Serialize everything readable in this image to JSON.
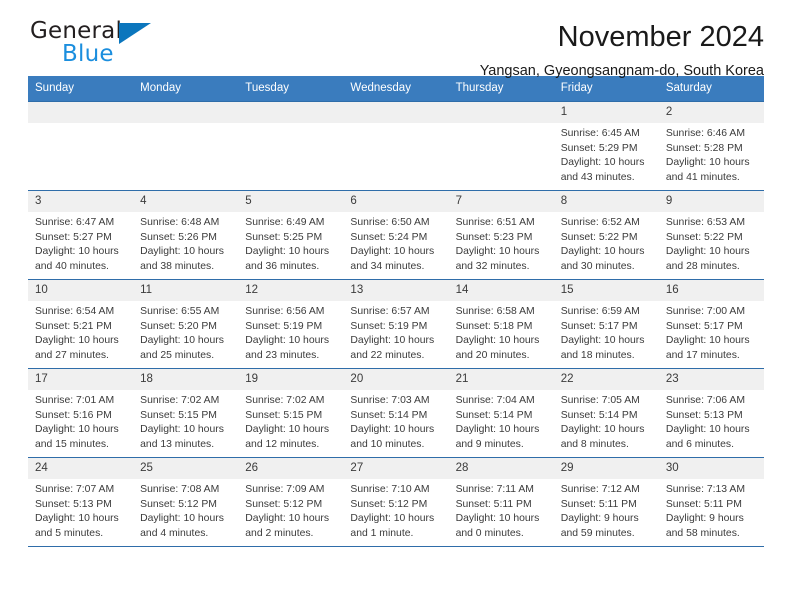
{
  "brand": {
    "name_part1": "General",
    "name_part2": "Blue",
    "triangle_color": "#0b76bd",
    "blue_text_color": "#1b8ede"
  },
  "header": {
    "title": "November 2024",
    "subtitle": "Yangsan, Gyeongsangnam-do, South Korea",
    "header_bg_color": "#3a7cbe",
    "row_border_color": "#2f6da9",
    "daynum_bg_color": "#f0f0f0"
  },
  "weekday_headers": [
    "Sunday",
    "Monday",
    "Tuesday",
    "Wednesday",
    "Thursday",
    "Friday",
    "Saturday"
  ],
  "weeks": [
    [
      {
        "day": "",
        "lines": []
      },
      {
        "day": "",
        "lines": []
      },
      {
        "day": "",
        "lines": []
      },
      {
        "day": "",
        "lines": []
      },
      {
        "day": "",
        "lines": []
      },
      {
        "day": "1",
        "lines": [
          "Sunrise: 6:45 AM",
          "Sunset: 5:29 PM",
          "Daylight: 10 hours",
          "and 43 minutes."
        ]
      },
      {
        "day": "2",
        "lines": [
          "Sunrise: 6:46 AM",
          "Sunset: 5:28 PM",
          "Daylight: 10 hours",
          "and 41 minutes."
        ]
      }
    ],
    [
      {
        "day": "3",
        "lines": [
          "Sunrise: 6:47 AM",
          "Sunset: 5:27 PM",
          "Daylight: 10 hours",
          "and 40 minutes."
        ]
      },
      {
        "day": "4",
        "lines": [
          "Sunrise: 6:48 AM",
          "Sunset: 5:26 PM",
          "Daylight: 10 hours",
          "and 38 minutes."
        ]
      },
      {
        "day": "5",
        "lines": [
          "Sunrise: 6:49 AM",
          "Sunset: 5:25 PM",
          "Daylight: 10 hours",
          "and 36 minutes."
        ]
      },
      {
        "day": "6",
        "lines": [
          "Sunrise: 6:50 AM",
          "Sunset: 5:24 PM",
          "Daylight: 10 hours",
          "and 34 minutes."
        ]
      },
      {
        "day": "7",
        "lines": [
          "Sunrise: 6:51 AM",
          "Sunset: 5:23 PM",
          "Daylight: 10 hours",
          "and 32 minutes."
        ]
      },
      {
        "day": "8",
        "lines": [
          "Sunrise: 6:52 AM",
          "Sunset: 5:22 PM",
          "Daylight: 10 hours",
          "and 30 minutes."
        ]
      },
      {
        "day": "9",
        "lines": [
          "Sunrise: 6:53 AM",
          "Sunset: 5:22 PM",
          "Daylight: 10 hours",
          "and 28 minutes."
        ]
      }
    ],
    [
      {
        "day": "10",
        "lines": [
          "Sunrise: 6:54 AM",
          "Sunset: 5:21 PM",
          "Daylight: 10 hours",
          "and 27 minutes."
        ]
      },
      {
        "day": "11",
        "lines": [
          "Sunrise: 6:55 AM",
          "Sunset: 5:20 PM",
          "Daylight: 10 hours",
          "and 25 minutes."
        ]
      },
      {
        "day": "12",
        "lines": [
          "Sunrise: 6:56 AM",
          "Sunset: 5:19 PM",
          "Daylight: 10 hours",
          "and 23 minutes."
        ]
      },
      {
        "day": "13",
        "lines": [
          "Sunrise: 6:57 AM",
          "Sunset: 5:19 PM",
          "Daylight: 10 hours",
          "and 22 minutes."
        ]
      },
      {
        "day": "14",
        "lines": [
          "Sunrise: 6:58 AM",
          "Sunset: 5:18 PM",
          "Daylight: 10 hours",
          "and 20 minutes."
        ]
      },
      {
        "day": "15",
        "lines": [
          "Sunrise: 6:59 AM",
          "Sunset: 5:17 PM",
          "Daylight: 10 hours",
          "and 18 minutes."
        ]
      },
      {
        "day": "16",
        "lines": [
          "Sunrise: 7:00 AM",
          "Sunset: 5:17 PM",
          "Daylight: 10 hours",
          "and 17 minutes."
        ]
      }
    ],
    [
      {
        "day": "17",
        "lines": [
          "Sunrise: 7:01 AM",
          "Sunset: 5:16 PM",
          "Daylight: 10 hours",
          "and 15 minutes."
        ]
      },
      {
        "day": "18",
        "lines": [
          "Sunrise: 7:02 AM",
          "Sunset: 5:15 PM",
          "Daylight: 10 hours",
          "and 13 minutes."
        ]
      },
      {
        "day": "19",
        "lines": [
          "Sunrise: 7:02 AM",
          "Sunset: 5:15 PM",
          "Daylight: 10 hours",
          "and 12 minutes."
        ]
      },
      {
        "day": "20",
        "lines": [
          "Sunrise: 7:03 AM",
          "Sunset: 5:14 PM",
          "Daylight: 10 hours",
          "and 10 minutes."
        ]
      },
      {
        "day": "21",
        "lines": [
          "Sunrise: 7:04 AM",
          "Sunset: 5:14 PM",
          "Daylight: 10 hours",
          "and 9 minutes."
        ]
      },
      {
        "day": "22",
        "lines": [
          "Sunrise: 7:05 AM",
          "Sunset: 5:14 PM",
          "Daylight: 10 hours",
          "and 8 minutes."
        ]
      },
      {
        "day": "23",
        "lines": [
          "Sunrise: 7:06 AM",
          "Sunset: 5:13 PM",
          "Daylight: 10 hours",
          "and 6 minutes."
        ]
      }
    ],
    [
      {
        "day": "24",
        "lines": [
          "Sunrise: 7:07 AM",
          "Sunset: 5:13 PM",
          "Daylight: 10 hours",
          "and 5 minutes."
        ]
      },
      {
        "day": "25",
        "lines": [
          "Sunrise: 7:08 AM",
          "Sunset: 5:12 PM",
          "Daylight: 10 hours",
          "and 4 minutes."
        ]
      },
      {
        "day": "26",
        "lines": [
          "Sunrise: 7:09 AM",
          "Sunset: 5:12 PM",
          "Daylight: 10 hours",
          "and 2 minutes."
        ]
      },
      {
        "day": "27",
        "lines": [
          "Sunrise: 7:10 AM",
          "Sunset: 5:12 PM",
          "Daylight: 10 hours",
          "and 1 minute."
        ]
      },
      {
        "day": "28",
        "lines": [
          "Sunrise: 7:11 AM",
          "Sunset: 5:11 PM",
          "Daylight: 10 hours",
          "and 0 minutes."
        ]
      },
      {
        "day": "29",
        "lines": [
          "Sunrise: 7:12 AM",
          "Sunset: 5:11 PM",
          "Daylight: 9 hours",
          "and 59 minutes."
        ]
      },
      {
        "day": "30",
        "lines": [
          "Sunrise: 7:13 AM",
          "Sunset: 5:11 PM",
          "Daylight: 9 hours",
          "and 58 minutes."
        ]
      }
    ]
  ]
}
